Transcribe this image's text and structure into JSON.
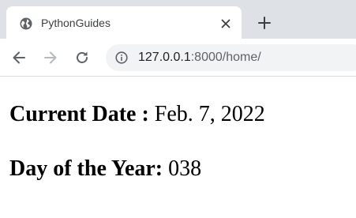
{
  "tab": {
    "favicon": "globe-icon",
    "title": "PythonGuides",
    "close": "close-icon"
  },
  "new_tab": "plus-icon",
  "toolbar": {
    "back": "back-arrow-icon",
    "forward": "forward-arrow-icon",
    "reload": "reload-icon",
    "site_info": "info-icon",
    "url_host": "127.0.0.1",
    "url_rest": ":8000/home/"
  },
  "page": {
    "date_label": "Current Date :",
    "date_value": "Feb. 7, 2022",
    "day_label": "Day of the Year:",
    "day_value": "038"
  },
  "colors": {
    "tabstrip": "#dee1e6",
    "omnibox": "#f1f3f4",
    "icon": "#5f6368"
  }
}
